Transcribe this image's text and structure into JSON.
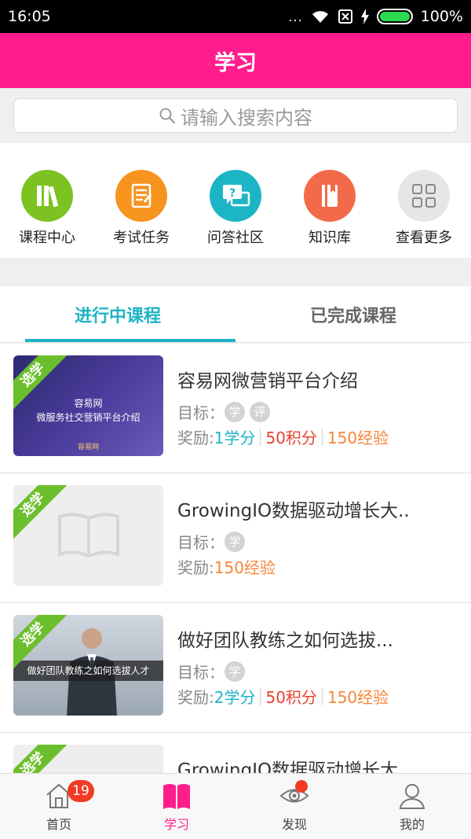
{
  "status_bar": {
    "time": "16:05",
    "dots": "...",
    "battery": "100%"
  },
  "header": {
    "title": "学习"
  },
  "search": {
    "placeholder": "请输入搜索内容"
  },
  "quick_nav": [
    {
      "label": "课程中心",
      "icon": "books-icon",
      "color": "#7cc221"
    },
    {
      "label": "考试任务",
      "icon": "checklist-icon",
      "color": "#f7941d"
    },
    {
      "label": "问答社区",
      "icon": "qa-icon",
      "color": "#1cb5c6"
    },
    {
      "label": "知识库",
      "icon": "book-icon",
      "color": "#f26a49"
    },
    {
      "label": "查看更多",
      "icon": "grid-icon",
      "color": "#e6e6e6"
    }
  ],
  "tabs": [
    {
      "label": "进行中课程",
      "active": true
    },
    {
      "label": "已完成课程",
      "active": false
    }
  ],
  "courses": [
    {
      "ribbon": "选学",
      "title": "容易网微营销平台介绍",
      "target_label": "目标：",
      "tags": [
        "学",
        "评"
      ],
      "reward_label": "奖励:",
      "credit": "1学分",
      "points": "50积分",
      "exp": "150经验",
      "thumb_text_1": "容易网",
      "thumb_text_2": "微服务社交营销平台介绍",
      "thumb_text_3": "容易网",
      "thumb_style": "purple"
    },
    {
      "ribbon": "选学",
      "title": "GrowingIO数据驱动增长大..",
      "target_label": "目标：",
      "tags": [
        "学"
      ],
      "reward_label": "奖励:",
      "credit": "",
      "points": "",
      "exp": "150经验",
      "thumb_style": "placeholder"
    },
    {
      "ribbon": "选学",
      "title": "做好团队教练之如何选拔...",
      "target_label": "目标：",
      "tags": [
        "学"
      ],
      "reward_label": "奖励:",
      "credit": "2学分",
      "points": "50积分",
      "exp": "150经验",
      "thumb_text_1": "做好团队教练之如何选拔人才",
      "thumb_style": "business"
    },
    {
      "ribbon": "选学",
      "title": "GrowingIO数据驱动增长大..",
      "target_label": "",
      "tags": [],
      "reward_label": "",
      "credit": "",
      "points": "",
      "exp": "",
      "thumb_style": "placeholder"
    }
  ],
  "bottom_nav": [
    {
      "label": "首页",
      "icon": "home-icon",
      "badge": "19",
      "active": false
    },
    {
      "label": "学习",
      "icon": "open-book-icon",
      "active": true
    },
    {
      "label": "发现",
      "icon": "eye-icon",
      "dot": true,
      "active": false
    },
    {
      "label": "我的",
      "icon": "user-icon",
      "active": false
    }
  ],
  "colors": {
    "brand": "#ff1d8e",
    "accent": "#1fb3c5",
    "ribbon": "#6cbf2c"
  }
}
